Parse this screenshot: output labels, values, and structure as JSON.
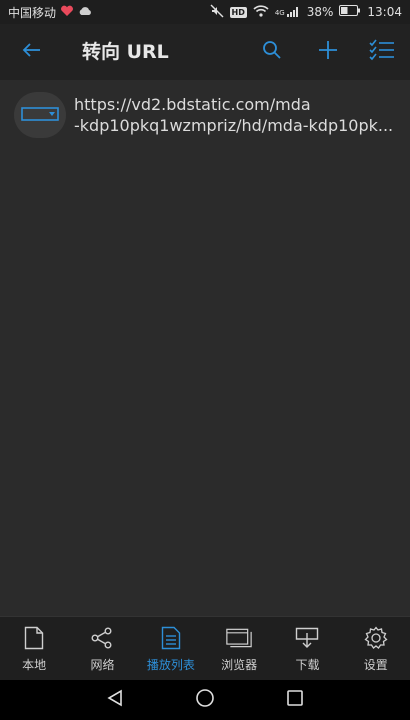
{
  "status_bar": {
    "carrier": "中国移动",
    "battery": "38%",
    "time": "13:04",
    "network": "4G",
    "hd_badge": "HD"
  },
  "app_bar": {
    "title": "转向 URL",
    "accent_color": "#2d8fd8"
  },
  "list": {
    "items": [
      {
        "line1": "https://vd2.bdstatic.com/mda",
        "line2": "-kdp10pkq1wzmpriz/hd/mda-kdp10pk..."
      }
    ]
  },
  "bottom_nav": {
    "items": [
      {
        "label": "本地",
        "icon": "file-icon",
        "active": false
      },
      {
        "label": "网络",
        "icon": "share-icon",
        "active": false
      },
      {
        "label": "播放列表",
        "icon": "playlist-icon",
        "active": true
      },
      {
        "label": "浏览器",
        "icon": "browser-icon",
        "active": false
      },
      {
        "label": "下载",
        "icon": "download-icon",
        "active": false
      },
      {
        "label": "设置",
        "icon": "gear-icon",
        "active": false
      }
    ]
  }
}
